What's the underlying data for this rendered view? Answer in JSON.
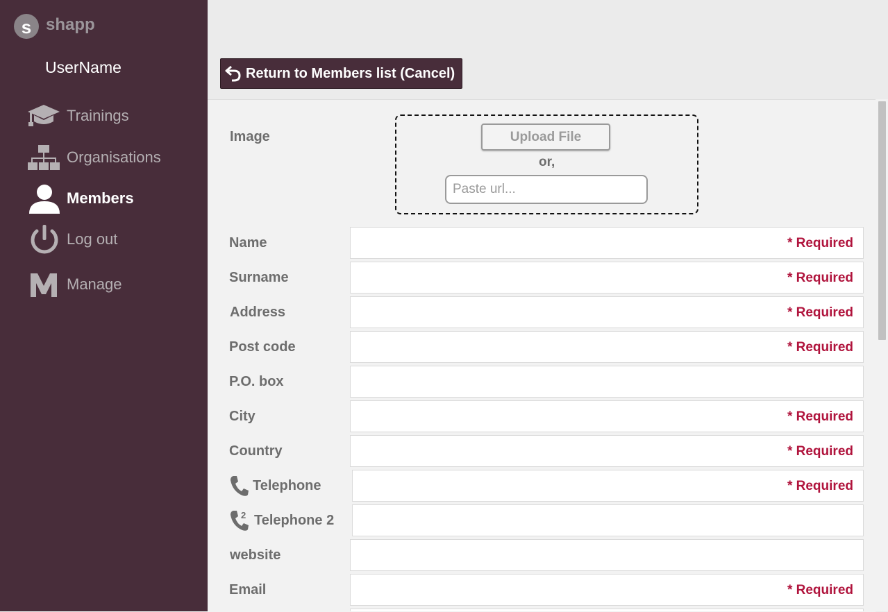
{
  "app": {
    "logo_letter": "s",
    "name": "shapp"
  },
  "sidebar": {
    "username": "UserName",
    "items": [
      {
        "label": "Trainings",
        "icon": "graduation-cap-icon"
      },
      {
        "label": "Organisations",
        "icon": "org-chart-icon"
      },
      {
        "label": "Members",
        "icon": "user-icon",
        "active": true
      },
      {
        "label": "Log out",
        "icon": "power-icon"
      },
      {
        "label": "Manage",
        "icon": "manage-m-icon"
      }
    ]
  },
  "toolbar": {
    "back_label": "Return to Members list (Cancel)"
  },
  "form": {
    "image": {
      "label": "Image",
      "upload_label": "Upload File",
      "or_text": "or,",
      "url_placeholder": "Paste url..."
    },
    "required_text": "* Required",
    "fields": [
      {
        "label": "Name",
        "required": true
      },
      {
        "label": "Surname",
        "required": true
      },
      {
        "label": "Address",
        "required": true
      },
      {
        "label": "Post code",
        "required": true
      },
      {
        "label": "P.O. box",
        "required": false
      },
      {
        "label": "City",
        "required": true
      },
      {
        "label": "Country",
        "required": true
      },
      {
        "label": "Telephone",
        "required": true,
        "icon": "phone-icon"
      },
      {
        "label": "Telephone 2",
        "required": false,
        "icon": "phone-2-icon"
      },
      {
        "label": "website",
        "required": false
      },
      {
        "label": "Email",
        "required": true
      }
    ]
  },
  "colors": {
    "sidebar_bg": "#482d3a",
    "required": "#b0133c",
    "content_bg": "#f2f2f2"
  }
}
